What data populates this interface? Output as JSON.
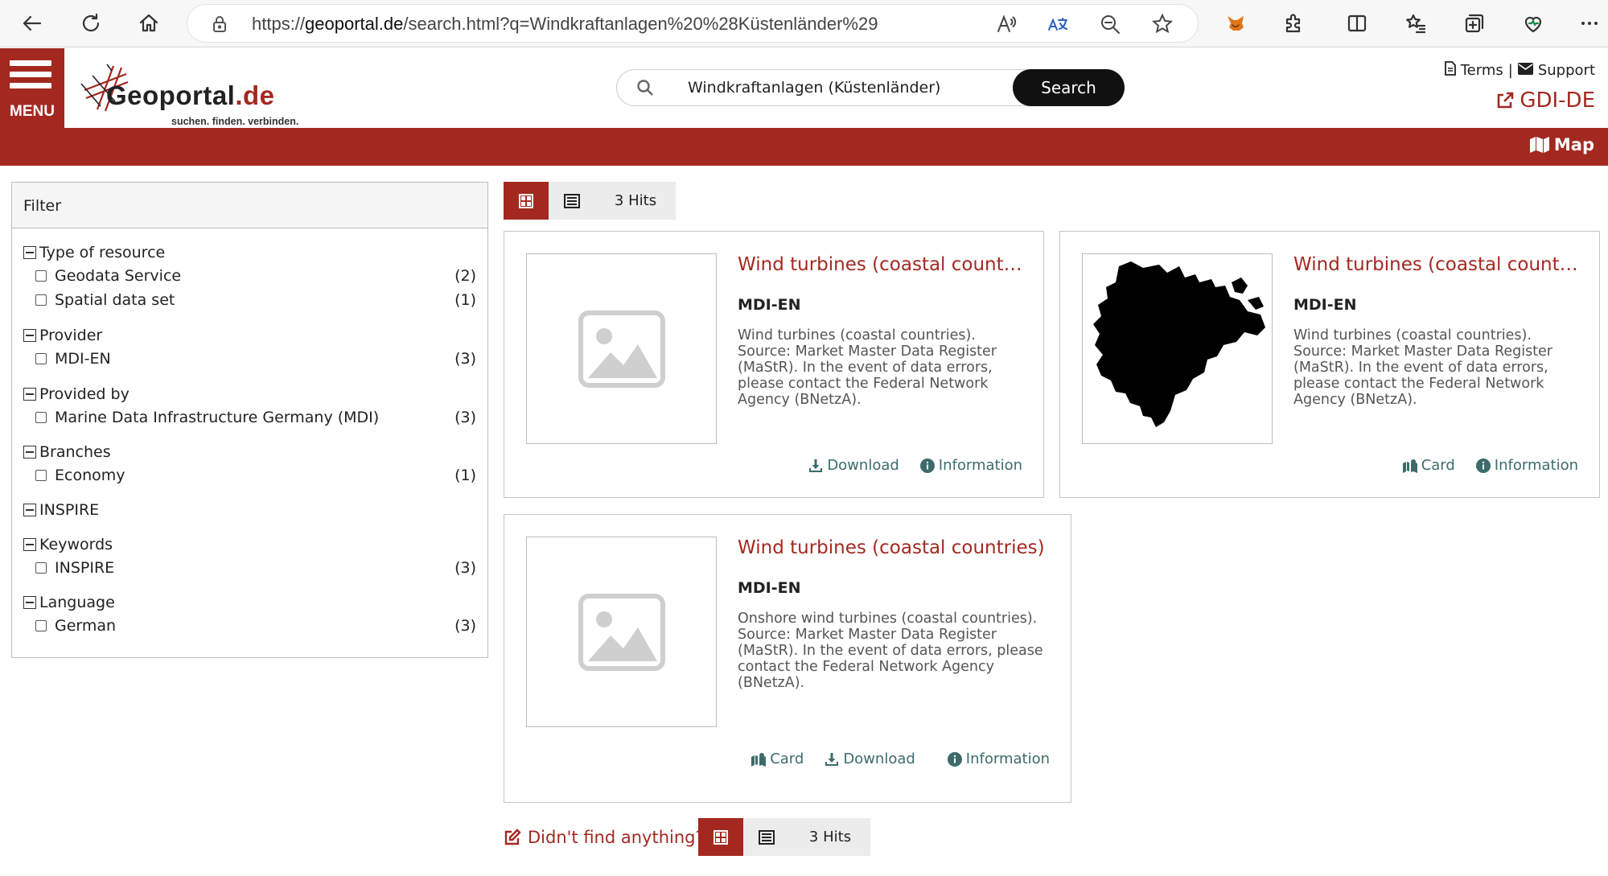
{
  "browser": {
    "url_prefix": "https://",
    "url_domain": "geoportal.de",
    "url_path": "/search.html?q=Windkraftanlagen%20%28Küstenländer%29"
  },
  "header": {
    "menu_label": "MENU",
    "logo_name": "Geoportal",
    "logo_tld": ".de",
    "logo_tagline": "suchen. finden. verbinden.",
    "search_value": "Windkraftanlagen (Küstenländer)",
    "search_button": "Search",
    "terms_label": "Terms",
    "separator": "|",
    "support_label": "Support",
    "gdide_label": "GDI-DE",
    "map_label": "Map"
  },
  "colors": {
    "brand_red": "#a32920",
    "action_teal": "#3d6b6b"
  },
  "filter": {
    "title": "Filter",
    "groups": [
      {
        "label": "Type of resource",
        "items": [
          {
            "label": "Geodata Service",
            "count": "(2)"
          },
          {
            "label": "Spatial data set",
            "count": "(1)"
          }
        ]
      },
      {
        "label": "Provider",
        "items": [
          {
            "label": "MDI-EN",
            "count": "(3)"
          }
        ]
      },
      {
        "label": "Provided by",
        "items": [
          {
            "label": "Marine Data Infrastructure Germany (MDI)",
            "count": "(3)"
          }
        ]
      },
      {
        "label": "Branches",
        "items": [
          {
            "label": "Economy",
            "count": "(1)"
          }
        ]
      },
      {
        "label": "INSPIRE",
        "items": []
      },
      {
        "label": "Keywords",
        "items": [
          {
            "label": "INSPIRE",
            "count": "(3)"
          }
        ]
      },
      {
        "label": "Language",
        "items": [
          {
            "label": "German",
            "count": "(3)"
          }
        ]
      }
    ]
  },
  "results": {
    "hits_label": "3 Hits",
    "cards": [
      {
        "title": "Wind turbines (coastal countri...",
        "provider": "MDI-EN",
        "description": "Wind turbines (coastal countries). Source: Market Master Data Register (MaStR). In the event of data errors, please contact the Federal Network Agency (BNetzA).",
        "thumbnail": "placeholder-image-icon",
        "actions": [
          "Download",
          "Information"
        ]
      },
      {
        "title": "Wind turbines (coastal countri...",
        "provider": "MDI-EN",
        "description": "Wind turbines (coastal countries). Source: Market Master Data Register (MaStR). In the event of data errors, please contact the Federal Network Agency (BNetzA).",
        "thumbnail": "map-preview",
        "actions": [
          "Card",
          "Information"
        ]
      },
      {
        "title": "Wind turbines (coastal countries)",
        "provider": "MDI-EN",
        "description": "Onshore wind turbines (coastal countries). Source: Market Master Data Register (MaStR). In the event of data errors, please contact the Federal Network Agency (BNetzA).",
        "thumbnail": "placeholder-image-icon",
        "actions": [
          "Card",
          "Download",
          "Information"
        ]
      }
    ],
    "not_found_label": "Didn't find anything?"
  }
}
